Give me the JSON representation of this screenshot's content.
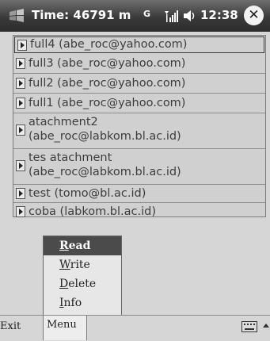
{
  "titlebar": {
    "title": "Time: 46791 m",
    "network_indicator": "G",
    "clock": "12:38",
    "close_label": "✕",
    "icons": [
      "windows-start-logo",
      "signal-icon",
      "volume-icon",
      "close-icon"
    ]
  },
  "list": {
    "items": [
      {
        "label": "full4 (abe_roc@yahoo.com)",
        "selected": true
      },
      {
        "label": "full3 (abe_roc@yahoo.com)",
        "selected": false
      },
      {
        "label": "full2 (abe_roc@yahoo.com)",
        "selected": false
      },
      {
        "label": "full1 (abe_roc@yahoo.com)",
        "selected": false
      },
      {
        "label": "atachment2\n(abe_roc@labkom.bl.ac.id)",
        "selected": false
      },
      {
        "label": "tes atachment\n(abe_roc@labkom.bl.ac.id)",
        "selected": false
      },
      {
        "label": "test (tomo@bl.ac.id)",
        "selected": false
      },
      {
        "label": "coba (labkom.bl.ac.id)",
        "selected": false
      }
    ]
  },
  "menu": {
    "items": [
      {
        "label": "Read",
        "mnemonic": "R",
        "rest": "ead",
        "selected": true
      },
      {
        "label": "Write",
        "mnemonic": "W",
        "rest": "rite",
        "selected": false
      },
      {
        "label": "Delete",
        "mnemonic": "D",
        "rest": "elete",
        "selected": false
      },
      {
        "label": "Info",
        "mnemonic": "I",
        "rest": "nfo",
        "selected": false
      }
    ]
  },
  "bottombar": {
    "left_softkey": "Exit",
    "right_softkey": "Menu",
    "icons": [
      "keyboard-icon",
      "arrow-up-icon"
    ]
  }
}
